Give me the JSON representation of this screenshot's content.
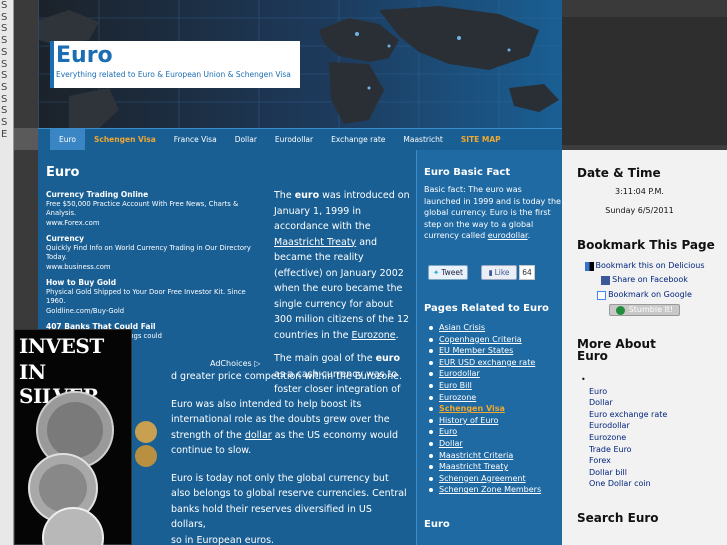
{
  "left_strip": {
    "chars": [
      "S",
      "S",
      "S",
      "S",
      "S",
      "S",
      "S",
      "S",
      "S",
      "S",
      "S",
      "E"
    ]
  },
  "header": {
    "title": "Euro",
    "tagline": "Everything related to Euro & European Union & Schengen Visa"
  },
  "nav": {
    "items": [
      {
        "label": "Euro",
        "active": true,
        "highlight": false
      },
      {
        "label": "Schengen Visa",
        "active": false,
        "highlight": true
      },
      {
        "label": "France Visa",
        "active": false,
        "highlight": false
      },
      {
        "label": "Dollar",
        "active": false,
        "highlight": false
      },
      {
        "label": "Eurodollar",
        "active": false,
        "highlight": false
      },
      {
        "label": "Exchange rate",
        "active": false,
        "highlight": false
      },
      {
        "label": "Maastricht",
        "active": false,
        "highlight": false
      },
      {
        "label": "SITE MAP",
        "active": false,
        "highlight": true
      }
    ]
  },
  "main": {
    "title": "Euro",
    "ads": [
      {
        "title": "Currency Trading Online",
        "desc": "Free $50,000 Practice Account With Free News, Charts & Analysis.",
        "url": "www.Forex.com"
      },
      {
        "title": "Currency",
        "desc": "Quickly Find Info on World Currency Trading in Our Directory Today.",
        "url": "www.business.com"
      },
      {
        "title": "How to Buy Gold",
        "desc": "Physical Gold Shipped to Your Door Free Investor Kit. Since 1960.",
        "url": "Goldline.com/Buy-Gold"
      },
      {
        "title": "407 Banks That Could Fail",
        "desc": "of these banks your savings could",
        "url": "com"
      }
    ],
    "adchoices": "AdChoices ▷",
    "p1_a": "The ",
    "p1_b": "euro",
    "p1_c": " was introduced on January 1, 1999 in accordance with the ",
    "p1_link": "Maastricht Treaty",
    "p1_d": " and became the reality (effective) on January 2002 when the euro became the single currency for about 300 milion citizens of the 12 countries in the ",
    "p1_link2": "Eurozone",
    "p1_e": ".",
    "p2_a": "The main goal of the ",
    "p2_b": "euro",
    "p2_c": " as a cash currency was to foster closer integration of",
    "p2_d": "d greater price competition within the Eurozone.",
    "p3_a": "Euro was also intended to help boost its international role as the doubts grew over the strength of the ",
    "p3_link": "dollar",
    "p3_b": " as the US economy would continue to slow.",
    "p4_a": "Euro is today not only the global currency but also belongs to global reserve currencies. Central banks hold their reserves diversified in US dollars,",
    "p4_b": "so in European euros.",
    "silver_ad": {
      "line1": "INVEST",
      "line2": "IN SILVER"
    }
  },
  "mid": {
    "basic_fact_title": "Euro Basic Fact",
    "basic_fact_text": "Basic fact: The euro was launched in 1999 and is today the global currency. Euro is the first step on the way to a global currency called ",
    "basic_fact_link": "eurodollar",
    "basic_fact_end": ".",
    "tweet": "Tweet",
    "like": "Like",
    "like_count": "64",
    "related_title": "Pages Related to Euro",
    "related": [
      {
        "label": "Asian Crisis",
        "hl": false
      },
      {
        "label": "Copenhagen Criteria",
        "hl": false
      },
      {
        "label": "EU Member States",
        "hl": false
      },
      {
        "label": "EUR USD exchange rate",
        "hl": false
      },
      {
        "label": "Eurodollar",
        "hl": false
      },
      {
        "label": "Euro Bill",
        "hl": false
      },
      {
        "label": "Eurozone",
        "hl": false
      },
      {
        "label": "Schengen Visa",
        "hl": true
      },
      {
        "label": "History of Euro",
        "hl": false
      },
      {
        "label": "Euro",
        "hl": false
      },
      {
        "label": "Dollar",
        "hl": false
      },
      {
        "label": "Maastricht Criteria",
        "hl": false
      },
      {
        "label": "Maastricht Treaty",
        "hl": false
      },
      {
        "label": "Schengen Agreement",
        "hl": false
      },
      {
        "label": "Schengen Zone Members",
        "hl": false
      }
    ],
    "euro2_title": "Euro"
  },
  "right": {
    "date_title": "Date & Time",
    "time": "3:11:04 P.M.",
    "date": "Sunday 6/5/2011",
    "bookmark_title": "Bookmark This Page",
    "bm_delicious": "Bookmark this on Delicious",
    "bm_facebook": "Share on Facebook",
    "bm_google": "Bookmark on Google",
    "bm_stumble": "Stumble It!",
    "more_title": "More About Euro",
    "more_links": [
      "Euro",
      "Dollar",
      "Euro exchange rate",
      "Eurodollar",
      "Eurozone",
      "Trade Euro",
      "Forex",
      "Dollar bill",
      "One Dollar coin"
    ],
    "search_title": "Search Euro"
  }
}
